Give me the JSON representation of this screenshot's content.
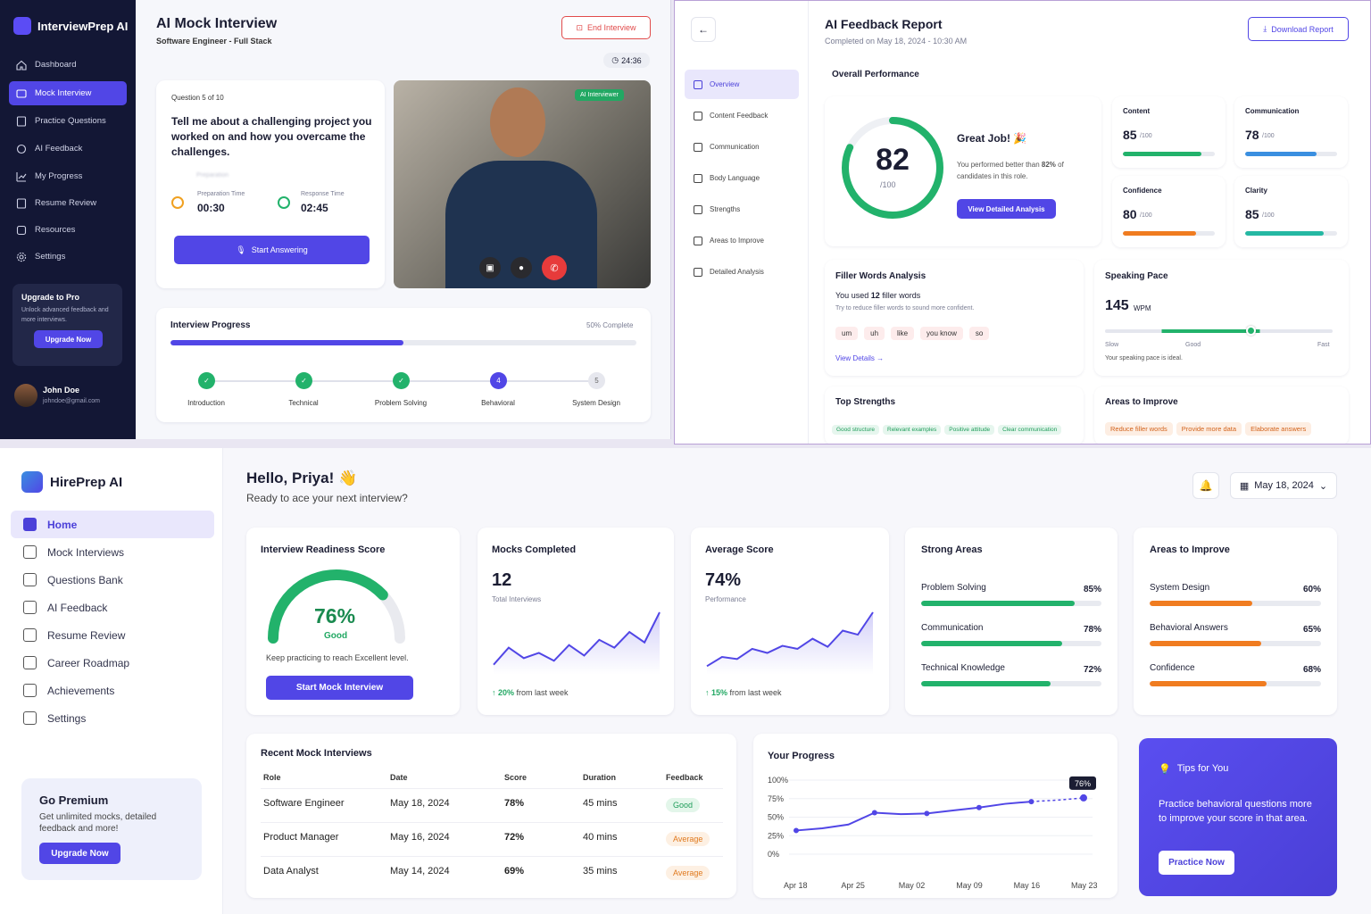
{
  "p1": {
    "brand": "InterviewPrep AI",
    "nav": [
      "Dashboard",
      "Mock Interview",
      "Practice Questions",
      "AI Feedback",
      "My Progress",
      "Resume Review",
      "Resources",
      "Settings"
    ],
    "title": "AI Mock Interview",
    "subtitle": "Software Engineer - Full Stack",
    "end_label": "End Interview",
    "timer": "24:36",
    "question_label": "Question 5 of 10",
    "question": "Tell me about a challenging project you worked on and how you overcame the challenges.",
    "prep_blur": "Preparation",
    "prep_label": "Preparation Time",
    "prep_time": "00:30",
    "resp_label": "Response Time",
    "resp_time": "02:45",
    "start_label": "Start Answering",
    "ai_badge": "AI Interviewer",
    "progress_title": "Interview Progress",
    "progress_pct": "50% Complete",
    "progress_fraction": 0.5,
    "steps": [
      {
        "n": "",
        "label": "Introduction"
      },
      {
        "n": "",
        "label": "Technical"
      },
      {
        "n": "",
        "label": "Problem Solving"
      },
      {
        "n": "4",
        "label": "Behavioral"
      },
      {
        "n": "5",
        "label": "System Design"
      }
    ],
    "upgrade_title": "Upgrade to Pro",
    "upgrade_text": "Unlock advanced feedback and more interviews.",
    "upgrade_btn": "Upgrade Now",
    "user_name": "John Doe",
    "user_email": "johndoe@gmail.com"
  },
  "p2": {
    "title": "AI Feedback Report",
    "completed": "Completed on May 18, 2024 - 10:30 AM",
    "download": "Download Report",
    "nav": [
      "Overview",
      "Content Feedback",
      "Communication",
      "Body Language",
      "Strengths",
      "Areas to Improve",
      "Detailed Analysis"
    ],
    "overall": "Overall Performance",
    "score": "82",
    "score_den": "/100",
    "score_value": 82,
    "great": "Great Job! 🎉",
    "great_pre": "You performed better than ",
    "great_pct": "82%",
    "great_post": " of candidates in this role.",
    "view_btn": "View Detailed Analysis",
    "metrics": [
      {
        "name": "Content",
        "val": "85",
        "den": "/100",
        "value": 85,
        "color": "#22b26b"
      },
      {
        "name": "Communication",
        "val": "78",
        "den": "/100",
        "value": 78,
        "color": "#3a8fe0"
      },
      {
        "name": "Confidence",
        "val": "80",
        "den": "/100",
        "value": 80,
        "color": "#f07c20"
      },
      {
        "name": "Clarity",
        "val": "85",
        "den": "/100",
        "value": 85,
        "color": "#25b8a3"
      }
    ],
    "filler_title": "Filler Words Analysis",
    "filler_pre": "You used ",
    "filler_count": "12",
    "filler_post": " filler words",
    "filler_hint": "Try to reduce filler words to sound more confident.",
    "fillers": [
      "um",
      "uh",
      "like",
      "you know",
      "so"
    ],
    "view_details": "View Details →",
    "pace_title": "Speaking Pace",
    "pace_val": "145",
    "pace_unit": "WPM",
    "pace_slow": "Slow",
    "pace_good": "Good",
    "pace_fast": "Fast",
    "pace_note": "Your speaking pace is ideal.",
    "pace_level": 0.64,
    "strengths_title": "Top Strengths",
    "strengths": [
      "Good structure",
      "Relevant examples",
      "Positive attitude",
      "Clear communication"
    ],
    "improve_title": "Areas to Improve",
    "improve": [
      "Reduce filler words",
      "Provide more data",
      "Elaborate answers"
    ]
  },
  "p3": {
    "brand": "HirePrep AI",
    "nav": [
      "Home",
      "Mock Interviews",
      "Questions Bank",
      "AI Feedback",
      "Resume Review",
      "Career Roadmap",
      "Achievements",
      "Settings"
    ],
    "hello": "Hello, Priya! 👋",
    "sub": "Ready to ace your next interview?",
    "date": "May 18, 2024",
    "premium_title": "Go Premium",
    "premium_text": "Get unlimited mocks, detailed feedback and more!",
    "premium_btn": "Upgrade Now",
    "readiness": {
      "title": "Interview Readiness Score",
      "value": "76%",
      "level": "Good",
      "pct": 76,
      "note": "Keep practicing to reach Excellent level.",
      "btn": "Start Mock Interview"
    },
    "mocks": {
      "title": "Mocks Completed",
      "value": "12",
      "sub": "Total Interviews",
      "trend_pct": "20%",
      "trend_rest": " from last week"
    },
    "avg": {
      "title": "Average Score",
      "value": "74%",
      "sub": "Performance",
      "trend_pct": "15%",
      "trend_rest": " from last week"
    },
    "strong": {
      "title": "Strong Areas",
      "items": [
        {
          "name": "Problem Solving",
          "pct": "85%",
          "v": 85
        },
        {
          "name": "Communication",
          "pct": "78%",
          "v": 78
        },
        {
          "name": "Technical Knowledge",
          "pct": "72%",
          "v": 72
        }
      ]
    },
    "weak": {
      "title": "Areas to Improve",
      "items": [
        {
          "name": "System Design",
          "pct": "60%",
          "v": 60
        },
        {
          "name": "Behavioral Answers",
          "pct": "65%",
          "v": 65
        },
        {
          "name": "Confidence",
          "pct": "68%",
          "v": 68
        }
      ]
    },
    "recent": {
      "title": "Recent Mock Interviews",
      "headers": [
        "Role",
        "Date",
        "Score",
        "Duration",
        "Feedback"
      ],
      "rows": [
        [
          "Software Engineer",
          "May 18, 2024",
          "78%",
          "45 mins",
          "Good"
        ],
        [
          "Product Manager",
          "May 16, 2024",
          "72%",
          "40 mins",
          "Average"
        ],
        [
          "Data Analyst",
          "May 14, 2024",
          "69%",
          "35 mins",
          "Average"
        ]
      ]
    },
    "progress_title": "Your Progress",
    "tips": {
      "title": "Tips for You",
      "text": "Practice behavioral questions more to improve your score in that area.",
      "btn": "Practice Now"
    }
  },
  "chart_data": [
    {
      "type": "line",
      "title": "Your Progress",
      "xlabel": "",
      "ylabel": "",
      "x": [
        "Apr 18",
        "Apr 21",
        "Apr 23",
        "Apr 25",
        "Apr 28",
        "May 02",
        "May 05",
        "May 09",
        "May 12",
        "May 16",
        "May 19",
        "May 23"
      ],
      "series": [
        {
          "values": [
            32,
            35,
            40,
            56,
            54,
            55,
            59,
            63,
            68,
            71,
            73,
            76
          ]
        }
      ],
      "ylim": [
        0,
        100
      ],
      "yticks": [
        "100%",
        "75%",
        "50%",
        "25%",
        "0%"
      ],
      "xticks": [
        "Apr 18",
        "Apr 25",
        "May 02",
        "May 09",
        "May 16",
        "May 23"
      ],
      "annotation": "76%",
      "grid": true
    },
    {
      "type": "area",
      "title": "Mocks Completed",
      "series": [
        {
          "values": [
            5,
            18,
            10,
            14,
            8,
            20,
            12,
            24,
            18,
            30,
            22,
            45
          ]
        }
      ],
      "grid": false
    },
    {
      "type": "area",
      "title": "Average Score",
      "series": [
        {
          "values": [
            5,
            14,
            12,
            22,
            18,
            25,
            22,
            32,
            24,
            40,
            36,
            58
          ]
        }
      ],
      "grid": false
    }
  ]
}
